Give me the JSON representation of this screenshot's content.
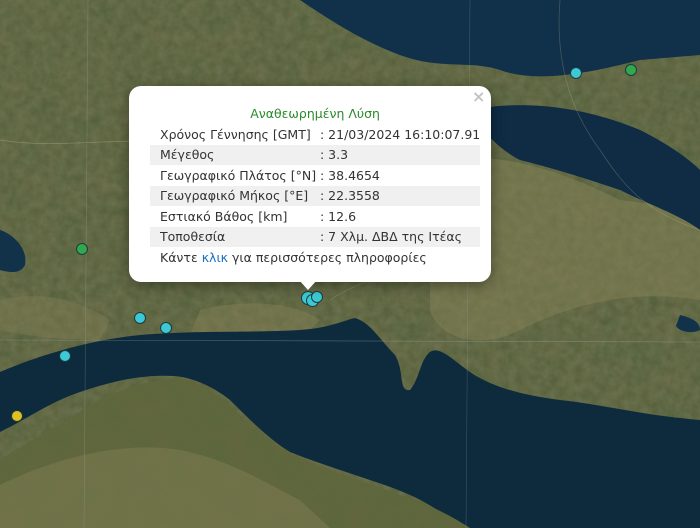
{
  "popup": {
    "title": "Αναθεωρημένη Λύση",
    "close_symbol": "×",
    "rows": [
      {
        "label": "Χρόνος Γέννησης [GMT]",
        "value": ": 21/03/2024 16:10:07.91"
      },
      {
        "label": "Μέγεθος",
        "value": ": 3.3"
      },
      {
        "label": "Γεωγραφικό Πλάτος [°N]",
        "value": ": 38.4654"
      },
      {
        "label": "Γεωγραφικό Μήκος [°E]",
        "value": ": 22.3558"
      },
      {
        "label": "Εστιακό Βάθος [km]",
        "value": ": 12.6"
      },
      {
        "label": "Τοποθεσία",
        "value": ": 7 Χλμ. ΔΒΔ της Ιτέας"
      }
    ],
    "more_prefix": "Κάντε ",
    "more_link": "κλικ",
    "more_suffix": " για περισσότερες πληροφορίες"
  },
  "colors": {
    "marker_cyan": "#3cc8d4",
    "marker_green": "#2fa84f",
    "marker_yellow": "#e0c020",
    "sea": "#0f2a3c",
    "land": "#4a5a36"
  }
}
